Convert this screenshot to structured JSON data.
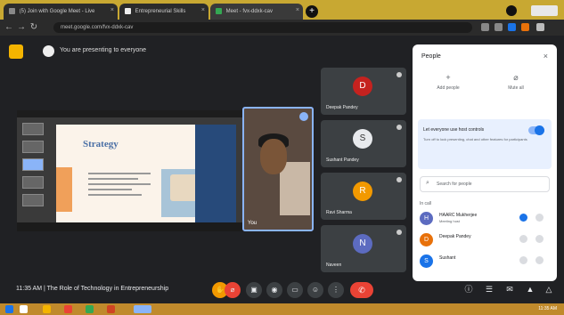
{
  "browser": {
    "tabs": [
      {
        "title": "(5) Join with Google Meet - Live"
      },
      {
        "title": "Entrepreneurial Skills"
      },
      {
        "title": "Meet - fvx-ddxk-cav"
      }
    ],
    "new_tab_label": "+",
    "url": "meet.google.com/fvx-ddxk-cav"
  },
  "meet": {
    "presenting_title": "You are presenting to everyone",
    "slide_title": "Strategy",
    "camera_name": "You",
    "tiles": [
      {
        "name": "Deepak Pandey",
        "initial": "D",
        "color": "#c5221f"
      },
      {
        "name": "Sushant Pandey",
        "initial": "S",
        "color": "#e8eaed"
      },
      {
        "name": "Ravi Sharma",
        "initial": "R",
        "color": "#f29900"
      },
      {
        "name": "Naveen",
        "initial": "N",
        "color": "#5c6bc0"
      }
    ],
    "meeting_time": "11:35 AM",
    "meeting_name": "The Role of Technology in Entrepreneurship",
    "end_call_icon": "phone-hangup-icon"
  },
  "panel": {
    "title": "People",
    "close": "×",
    "actions": [
      {
        "label": "Add people",
        "icon": "person-add-icon",
        "glyph": "+"
      },
      {
        "label": "Mute all",
        "icon": "mic-off-icon",
        "glyph": "⌀"
      }
    ],
    "lock": {
      "title": "Let everyone use host controls",
      "desc": "Turn off to lock presenting, chat and other features for participants"
    },
    "search_placeholder": "Search for people",
    "section": "In call",
    "participants": [
      {
        "name": "HAARC Mukherjee",
        "sub": "Meeting host",
        "initial": "H",
        "color": "#5c6bc0"
      },
      {
        "name": "Deepak Pandey",
        "sub": "",
        "initial": "D",
        "color": "#e8710a"
      },
      {
        "name": "Sushant",
        "sub": "",
        "initial": "S",
        "color": "#1a73e8"
      }
    ]
  },
  "colors": {
    "accent": "#1a73e8",
    "end_call": "#ea4335",
    "meet_bg": "#202124"
  }
}
